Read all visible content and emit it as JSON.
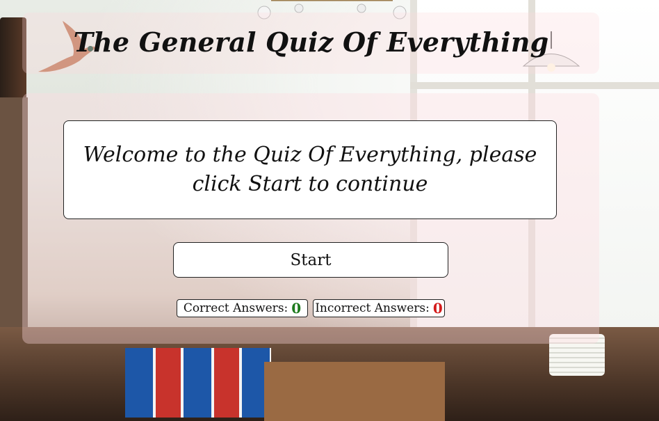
{
  "header": {
    "title": "The General Quiz Of Everything"
  },
  "question": {
    "text": "Welcome to the Quiz Of Everything, please click Start to continue"
  },
  "controls": {
    "start_label": "Start"
  },
  "scores": {
    "correct_label": "Correct Answers:",
    "correct_value": "0",
    "incorrect_label": "Incorrect Answers:",
    "incorrect_value": "0"
  },
  "colors": {
    "correct": "#1e7b1e",
    "incorrect": "#d41c1c",
    "panel": "rgba(255,220,225,0.36)"
  },
  "background": {
    "scene": "shop-interior-photo"
  }
}
